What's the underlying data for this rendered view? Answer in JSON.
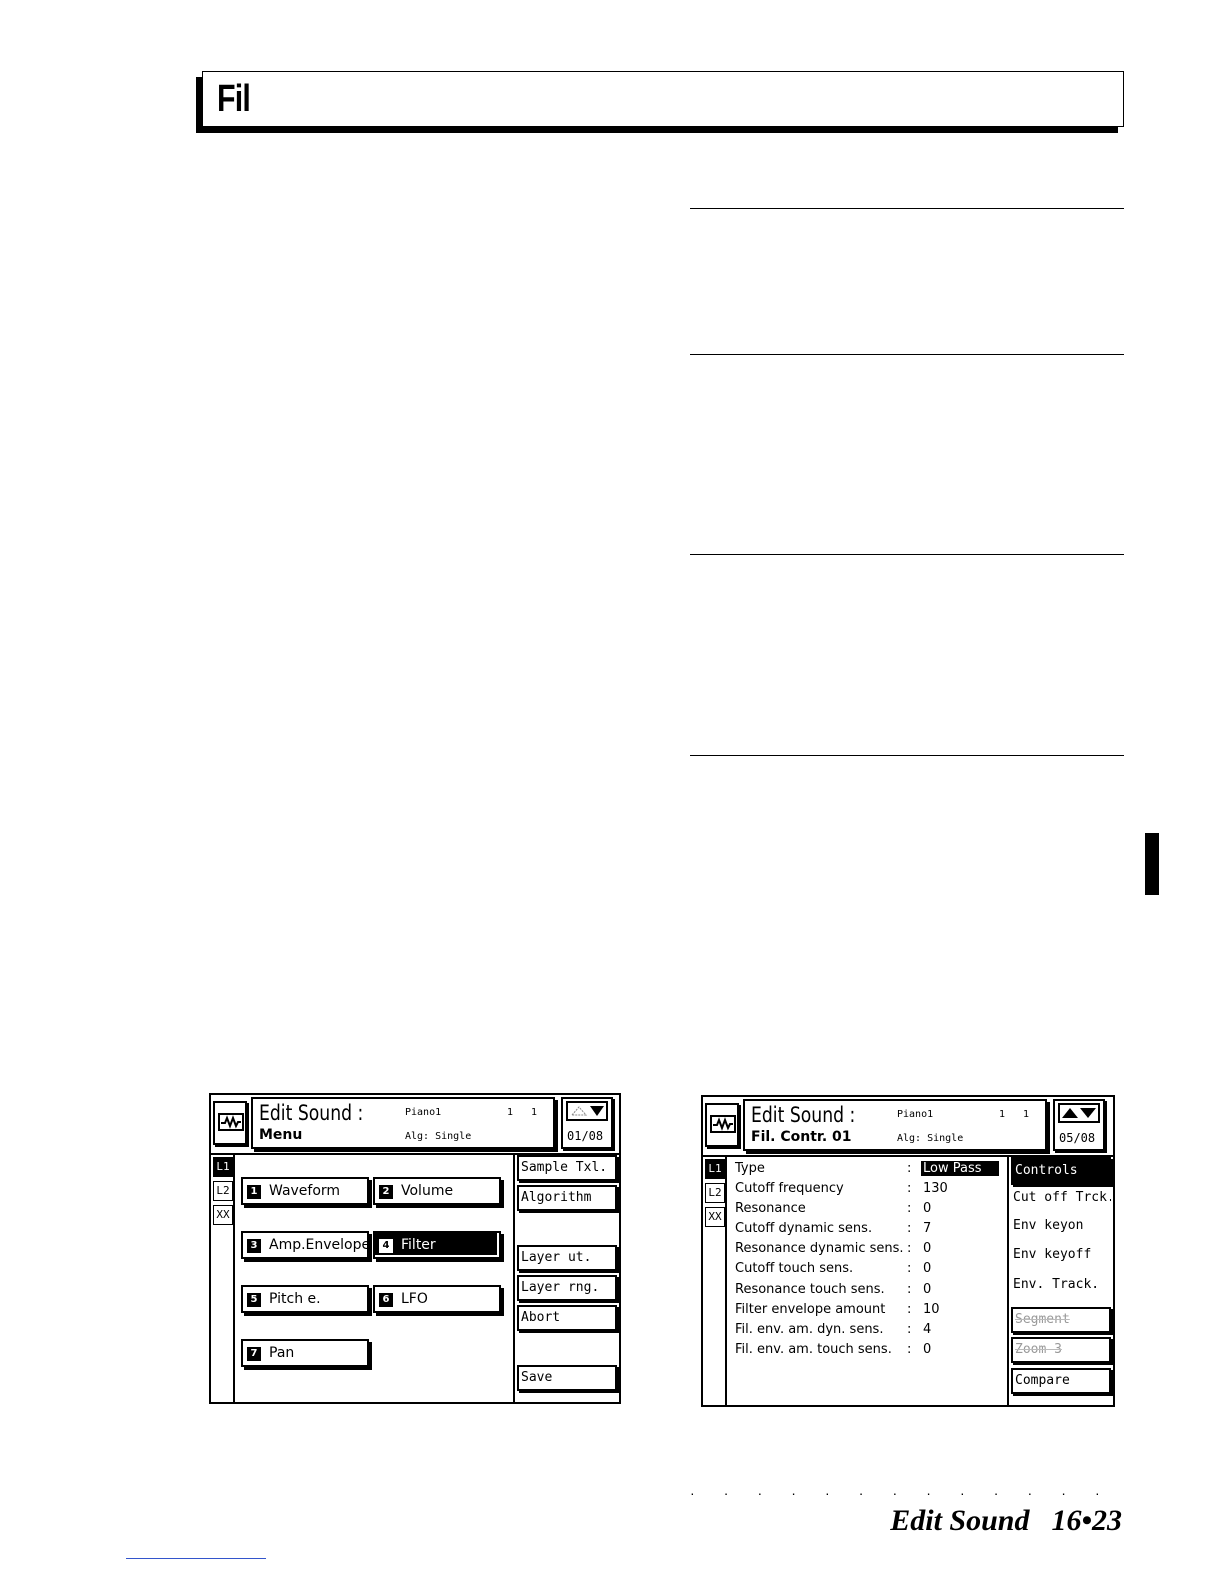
{
  "header": {
    "title": "Fil"
  },
  "footer": {
    "section": "Edit Sound",
    "page": "16•23",
    "dots": "· · · · · · · · · · · · · · · · · · · · · · · ·"
  },
  "screen_menu": {
    "title": "Edit Sound :",
    "subtitle": "Menu",
    "sound": "Piano1",
    "n1": "1",
    "n2": "1",
    "alg": "Alg: Single",
    "page": "01/08",
    "layers": [
      "L1",
      "L2",
      "XX"
    ],
    "buttons": [
      {
        "num": "1",
        "label": "Waveform"
      },
      {
        "num": "2",
        "label": "Volume"
      },
      {
        "num": "3",
        "label": "Amp.Envelope"
      },
      {
        "num": "4",
        "label": "Filter"
      },
      {
        "num": "5",
        "label": "Pitch e."
      },
      {
        "num": "6",
        "label": "LFO"
      },
      {
        "num": "7",
        "label": "Pan"
      }
    ],
    "side": [
      "Sample Txl.",
      "Algorithm",
      "Layer ut.",
      "Layer rng.",
      "Abort",
      "Save"
    ]
  },
  "screen_filter": {
    "title": "Edit Sound :",
    "subtitle": "Fil. Contr. 01",
    "sound": "Piano1",
    "n1": "1",
    "n2": "1",
    "alg": "Alg: Single",
    "page": "05/08",
    "layers": [
      "L1",
      "L2",
      "XX"
    ],
    "params": [
      {
        "label": "Type",
        "value": "Low Pass"
      },
      {
        "label": "Cutoff frequency",
        "value": "130"
      },
      {
        "label": "Resonance",
        "value": "0"
      },
      {
        "label": "Cutoff dynamic sens.",
        "value": "7"
      },
      {
        "label": "Resonance dynamic sens.",
        "value": "0"
      },
      {
        "label": "Cutoff touch sens.",
        "value": "0"
      },
      {
        "label": "Resonance touch sens.",
        "value": "0"
      },
      {
        "label": "Filter envelope amount",
        "value": "10"
      },
      {
        "label": "Fil. env. am. dyn. sens.",
        "value": "4"
      },
      {
        "label": "Fil. env. am. touch sens.",
        "value": "0"
      }
    ],
    "colon": ":",
    "side": [
      "Controls",
      "Cut off Trck.",
      "Env keyon",
      "Env keyoff",
      "Env. Track.",
      "Segment",
      "Zoom 3",
      "Compare"
    ]
  }
}
